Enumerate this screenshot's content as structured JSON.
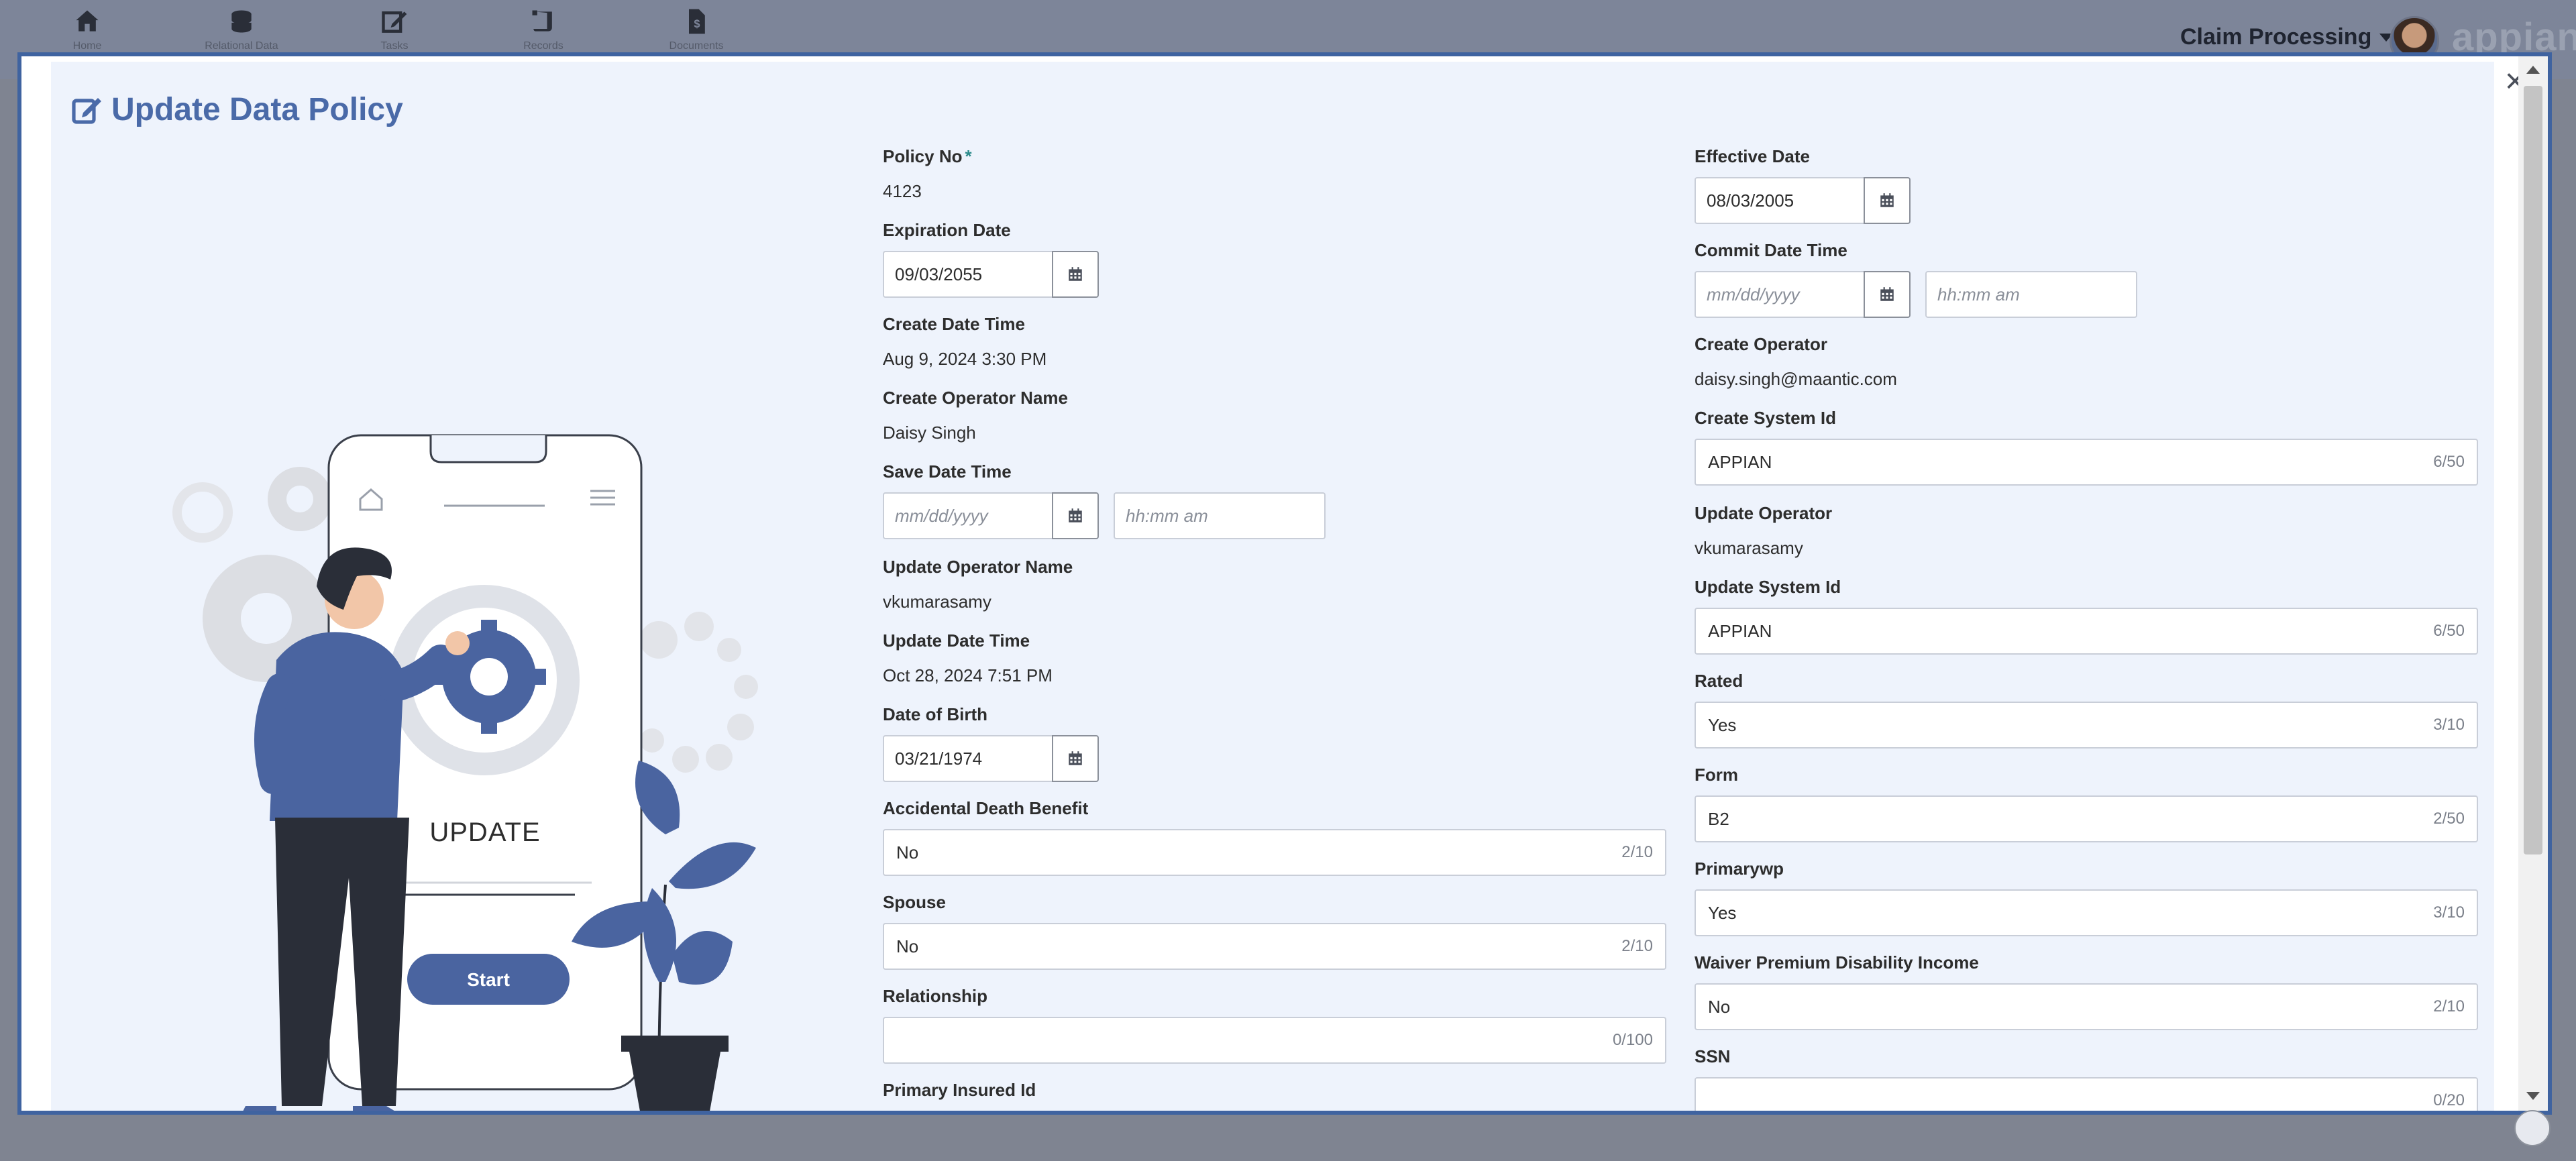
{
  "nav": {
    "items": [
      {
        "icon": "home-icon",
        "label": "Home"
      },
      {
        "icon": "database-icon",
        "label": "Relational Data"
      },
      {
        "icon": "edit-icon",
        "label": "Tasks"
      },
      {
        "icon": "scroll-icon",
        "label": "Records"
      },
      {
        "icon": "document-icon",
        "label": "Documents"
      }
    ],
    "app_menu": "Claim Processing",
    "brand": "appian"
  },
  "modal": {
    "title": "Update Data Policy",
    "close_label": "×",
    "illustration": {
      "screen_text": "UPDATE",
      "start_label": "Start"
    },
    "left": {
      "policy_no_label": "Policy No",
      "policy_no_required": "*",
      "policy_no_value": "4123",
      "expiration_date_label": "Expiration Date",
      "expiration_date_value": "09/03/2055",
      "create_date_time_label": "Create Date Time",
      "create_date_time_value": "Aug 9, 2024 3:30 PM",
      "create_operator_name_label": "Create Operator Name",
      "create_operator_name_value": "Daisy Singh",
      "save_date_time_label": "Save Date Time",
      "save_date_placeholder": "mm/dd/yyyy",
      "save_time_placeholder": "hh:mm am",
      "update_operator_name_label": "Update Operator Name",
      "update_operator_name_value": "vkumarasamy",
      "update_date_time_label": "Update Date Time",
      "update_date_time_value": "Oct 28, 2024 7:51 PM",
      "date_of_birth_label": "Date of Birth",
      "date_of_birth_value": "03/21/1974",
      "accidental_death_label": "Accidental Death Benefit",
      "accidental_death_value": "No",
      "accidental_death_count": "2/10",
      "spouse_label": "Spouse",
      "spouse_value": "No",
      "spouse_count": "2/10",
      "relationship_label": "Relationship",
      "relationship_value": "",
      "relationship_count": "0/100",
      "primary_insured_label": "Primary Insured Id"
    },
    "right": {
      "effective_date_label": "Effective Date",
      "effective_date_value": "08/03/2005",
      "commit_date_time_label": "Commit Date Time",
      "commit_date_placeholder": "mm/dd/yyyy",
      "commit_time_placeholder": "hh:mm am",
      "create_operator_label": "Create Operator",
      "create_operator_value": "daisy.singh@maantic.com",
      "create_system_id_label": "Create System Id",
      "create_system_id_value": "APPIAN",
      "create_system_id_count": "6/50",
      "update_operator_label": "Update Operator",
      "update_operator_value": "vkumarasamy",
      "update_system_id_label": "Update System Id",
      "update_system_id_value": "APPIAN",
      "update_system_id_count": "6/50",
      "rated_label": "Rated",
      "rated_value": "Yes",
      "rated_count": "3/10",
      "form_label": "Form",
      "form_value": "B2",
      "form_count": "2/50",
      "primarywp_label": "Primarywp",
      "primarywp_value": "Yes",
      "primarywp_count": "3/10",
      "waiver_label": "Waiver Premium Disability Income",
      "waiver_value": "No",
      "waiver_count": "2/10",
      "ssn_label": "SSN",
      "ssn_value": "",
      "ssn_count": "0/20"
    }
  },
  "colors": {
    "accent": "#4a6aa8",
    "modal_border": "#3f63a0",
    "panel_bg": "#eef3fc",
    "illustration_blue": "#4a64a0"
  }
}
